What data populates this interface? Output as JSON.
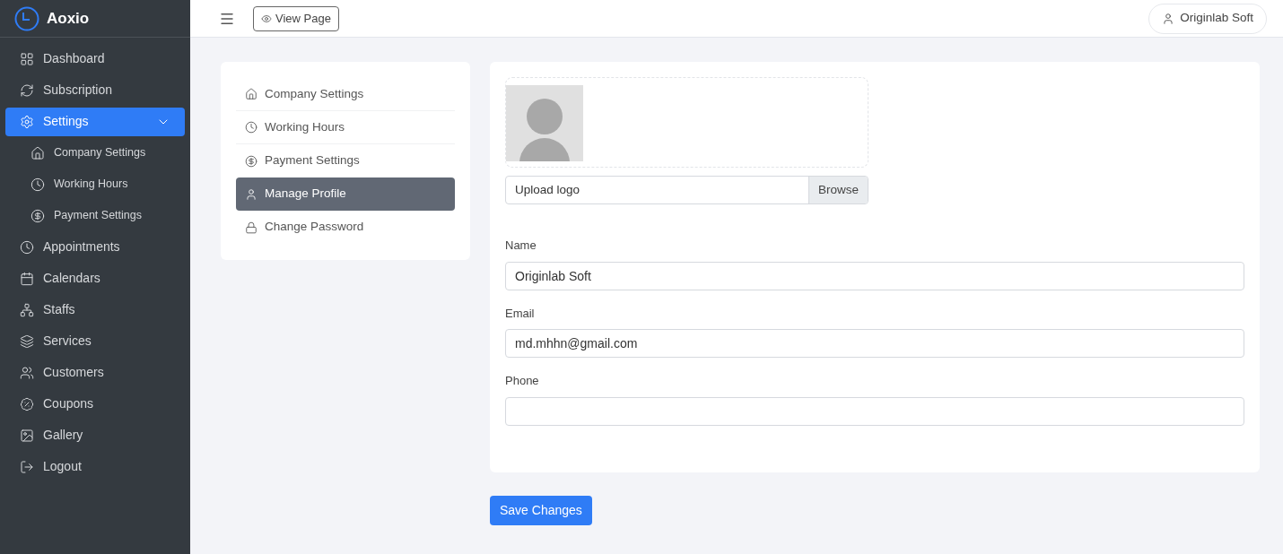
{
  "brand": {
    "name": "Aoxio"
  },
  "sidebar": {
    "items": [
      {
        "label": "Dashboard",
        "selected": false
      },
      {
        "label": "Subscription",
        "selected": false
      },
      {
        "label": "Settings",
        "selected": true,
        "expanded": true,
        "children": [
          {
            "label": "Company Settings"
          },
          {
            "label": "Working Hours"
          },
          {
            "label": "Payment Settings"
          }
        ]
      },
      {
        "label": "Appointments",
        "selected": false
      },
      {
        "label": "Calendars",
        "selected": false
      },
      {
        "label": "Staffs",
        "selected": false
      },
      {
        "label": "Services",
        "selected": false
      },
      {
        "label": "Customers",
        "selected": false
      },
      {
        "label": "Coupons",
        "selected": false
      },
      {
        "label": "Gallery",
        "selected": false
      },
      {
        "label": "Logout",
        "selected": false
      }
    ]
  },
  "header": {
    "view_page": "View Page",
    "user": "Originlab Soft"
  },
  "settings_menu": [
    {
      "label": "Company Settings",
      "selected": false
    },
    {
      "label": "Working Hours",
      "selected": false
    },
    {
      "label": "Payment Settings",
      "selected": false
    },
    {
      "label": "Manage Profile",
      "selected": true
    },
    {
      "label": "Change Password",
      "selected": false
    }
  ],
  "profile": {
    "upload_label": "Upload logo",
    "browse": "Browse",
    "fields": [
      {
        "label": "Name",
        "value": "Originlab Soft"
      },
      {
        "label": "Email",
        "value": "md.mhhn@gmail.com"
      },
      {
        "label": "Phone"
      }
    ]
  },
  "save_button": "Save Changes"
}
